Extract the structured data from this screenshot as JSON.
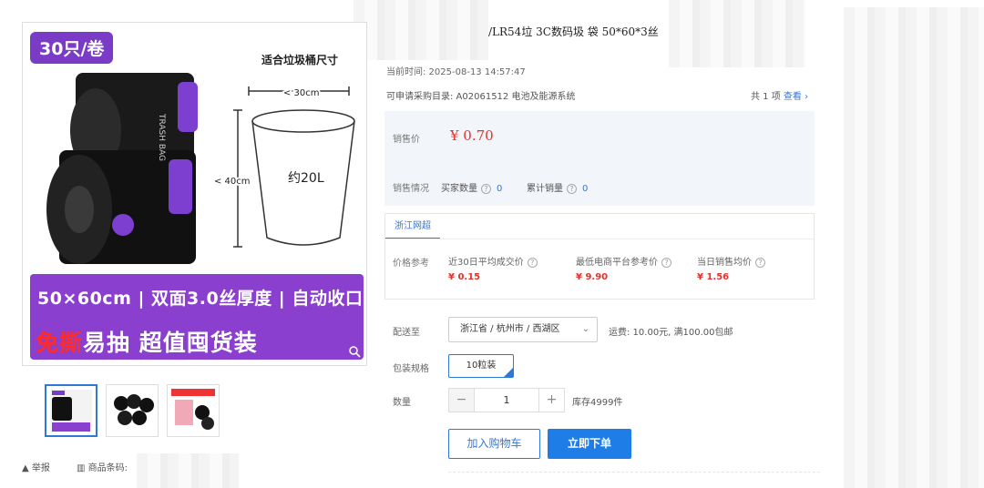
{
  "product": {
    "title_partial": "/LR54垃 3C数码圾 袋 50*60*3丝",
    "time": "当前时间: 2025-08-13 14:57:47",
    "catalog": "可申请采购目录: A02061512 电池及能源系统",
    "count_prefix": "共 1 项",
    "count_link": "查看"
  },
  "image": {
    "badge": "30只/卷",
    "fit_title": "适合垃圾桶尺寸",
    "width_dim": "< 30cm",
    "height_dim": "< 40cm",
    "volume": "约20L",
    "band_line1": "50×60cm | 双面3.0丝厚度 | 自动收口",
    "band_red": "免撕",
    "band_rest": "易抽 超值囤货装",
    "bag_text": "TRASH BAG"
  },
  "footer_left": {
    "report": "举报",
    "barcode": "商品条码:"
  },
  "price": {
    "label": "销售价",
    "value": "¥ 0.70"
  },
  "sales": {
    "label": "销售情况",
    "buyers_label": "买家数量",
    "buyers_value": "0",
    "total_label": "累计销量",
    "total_value": "0"
  },
  "reference": {
    "tab": "浙江网超",
    "label": "价格参考",
    "columns": [
      {
        "title": "近30日平均成交价",
        "value": "¥ 0.15"
      },
      {
        "title": "最低电商平台参考价",
        "value": "¥ 9.90"
      },
      {
        "title": "当日销售均价",
        "value": "¥ 1.56"
      }
    ]
  },
  "delivery": {
    "label": "配送至",
    "location": "浙江省 / 杭州市 / 西湖区",
    "shipping": "运费: 10.00元, 满100.00包邮"
  },
  "spec": {
    "label": "包装规格",
    "option": "10粒装"
  },
  "quantity": {
    "label": "数量",
    "value": "1",
    "minus": "−",
    "plus": "+",
    "stock": "库存4999件"
  },
  "actions": {
    "cart": "加入购物车",
    "buy": "立即下单"
  },
  "colors": {
    "accent": "#2f78d6",
    "price": "#e4312b",
    "promo": "#8a3fcf"
  }
}
